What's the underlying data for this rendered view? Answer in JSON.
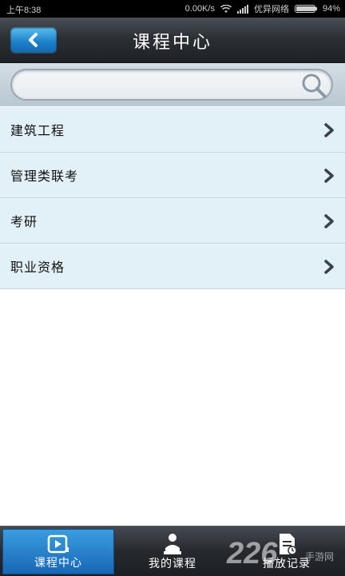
{
  "statusbar": {
    "time": "上午8:38",
    "speed": "0.00K/s",
    "carrier": "优异网络",
    "battery": "94%",
    "battery_level": 0.94
  },
  "header": {
    "title": "课程中心",
    "back_icon": "chevron-left-icon"
  },
  "search": {
    "value": "",
    "placeholder": "",
    "icon": "search-icon"
  },
  "categories": [
    {
      "label": "建筑工程"
    },
    {
      "label": "管理类联考"
    },
    {
      "label": "考研"
    },
    {
      "label": "职业资格"
    }
  ],
  "bottom_nav": {
    "tabs": [
      {
        "label": "课程中心",
        "icon": "video-course-icon",
        "active": true
      },
      {
        "label": "我的课程",
        "icon": "reader-icon",
        "active": false
      },
      {
        "label": "播放记录",
        "icon": "document-history-icon",
        "active": false
      }
    ]
  },
  "watermark": {
    "text": "226",
    "subtext": "手游网"
  },
  "colors": {
    "accent": "#1c7fc9",
    "list_bg": "#e2f0f8",
    "header_bg": "#2c3035"
  }
}
